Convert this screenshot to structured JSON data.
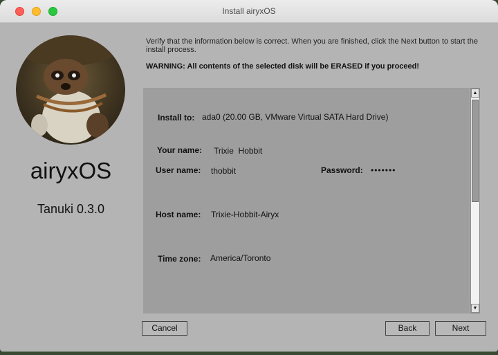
{
  "window": {
    "title": "Install airyxOS"
  },
  "sidebar": {
    "os_name": "airyxOS",
    "version": "Tanuki 0.3.0"
  },
  "content": {
    "intro": "Verify that the information below is correct. When you are finished, click the Next button to start the install process.",
    "warning": "WARNING: All contents of the selected disk will be ERASED if you proceed!"
  },
  "summary": {
    "install_to": {
      "label": "Install to:",
      "value": "ada0 (20.00 GB, VMware Virtual SATA Hard Drive)"
    },
    "your_name": {
      "label": "Your name:",
      "value": "Trixie  Hobbit"
    },
    "user_name": {
      "label": "User name:",
      "value": "thobbit"
    },
    "password": {
      "label": "Password:",
      "value": "•••••••"
    },
    "host_name": {
      "label": "Host name:",
      "value": "Trixie-Hobbit-Airyx"
    },
    "time_zone": {
      "label": "Time zone:",
      "value": "America/Toronto"
    }
  },
  "buttons": {
    "cancel": "Cancel",
    "back": "Back",
    "next": "Next"
  },
  "colors": {
    "panel": "#9e9e9e",
    "window": "#b4b4b4"
  }
}
